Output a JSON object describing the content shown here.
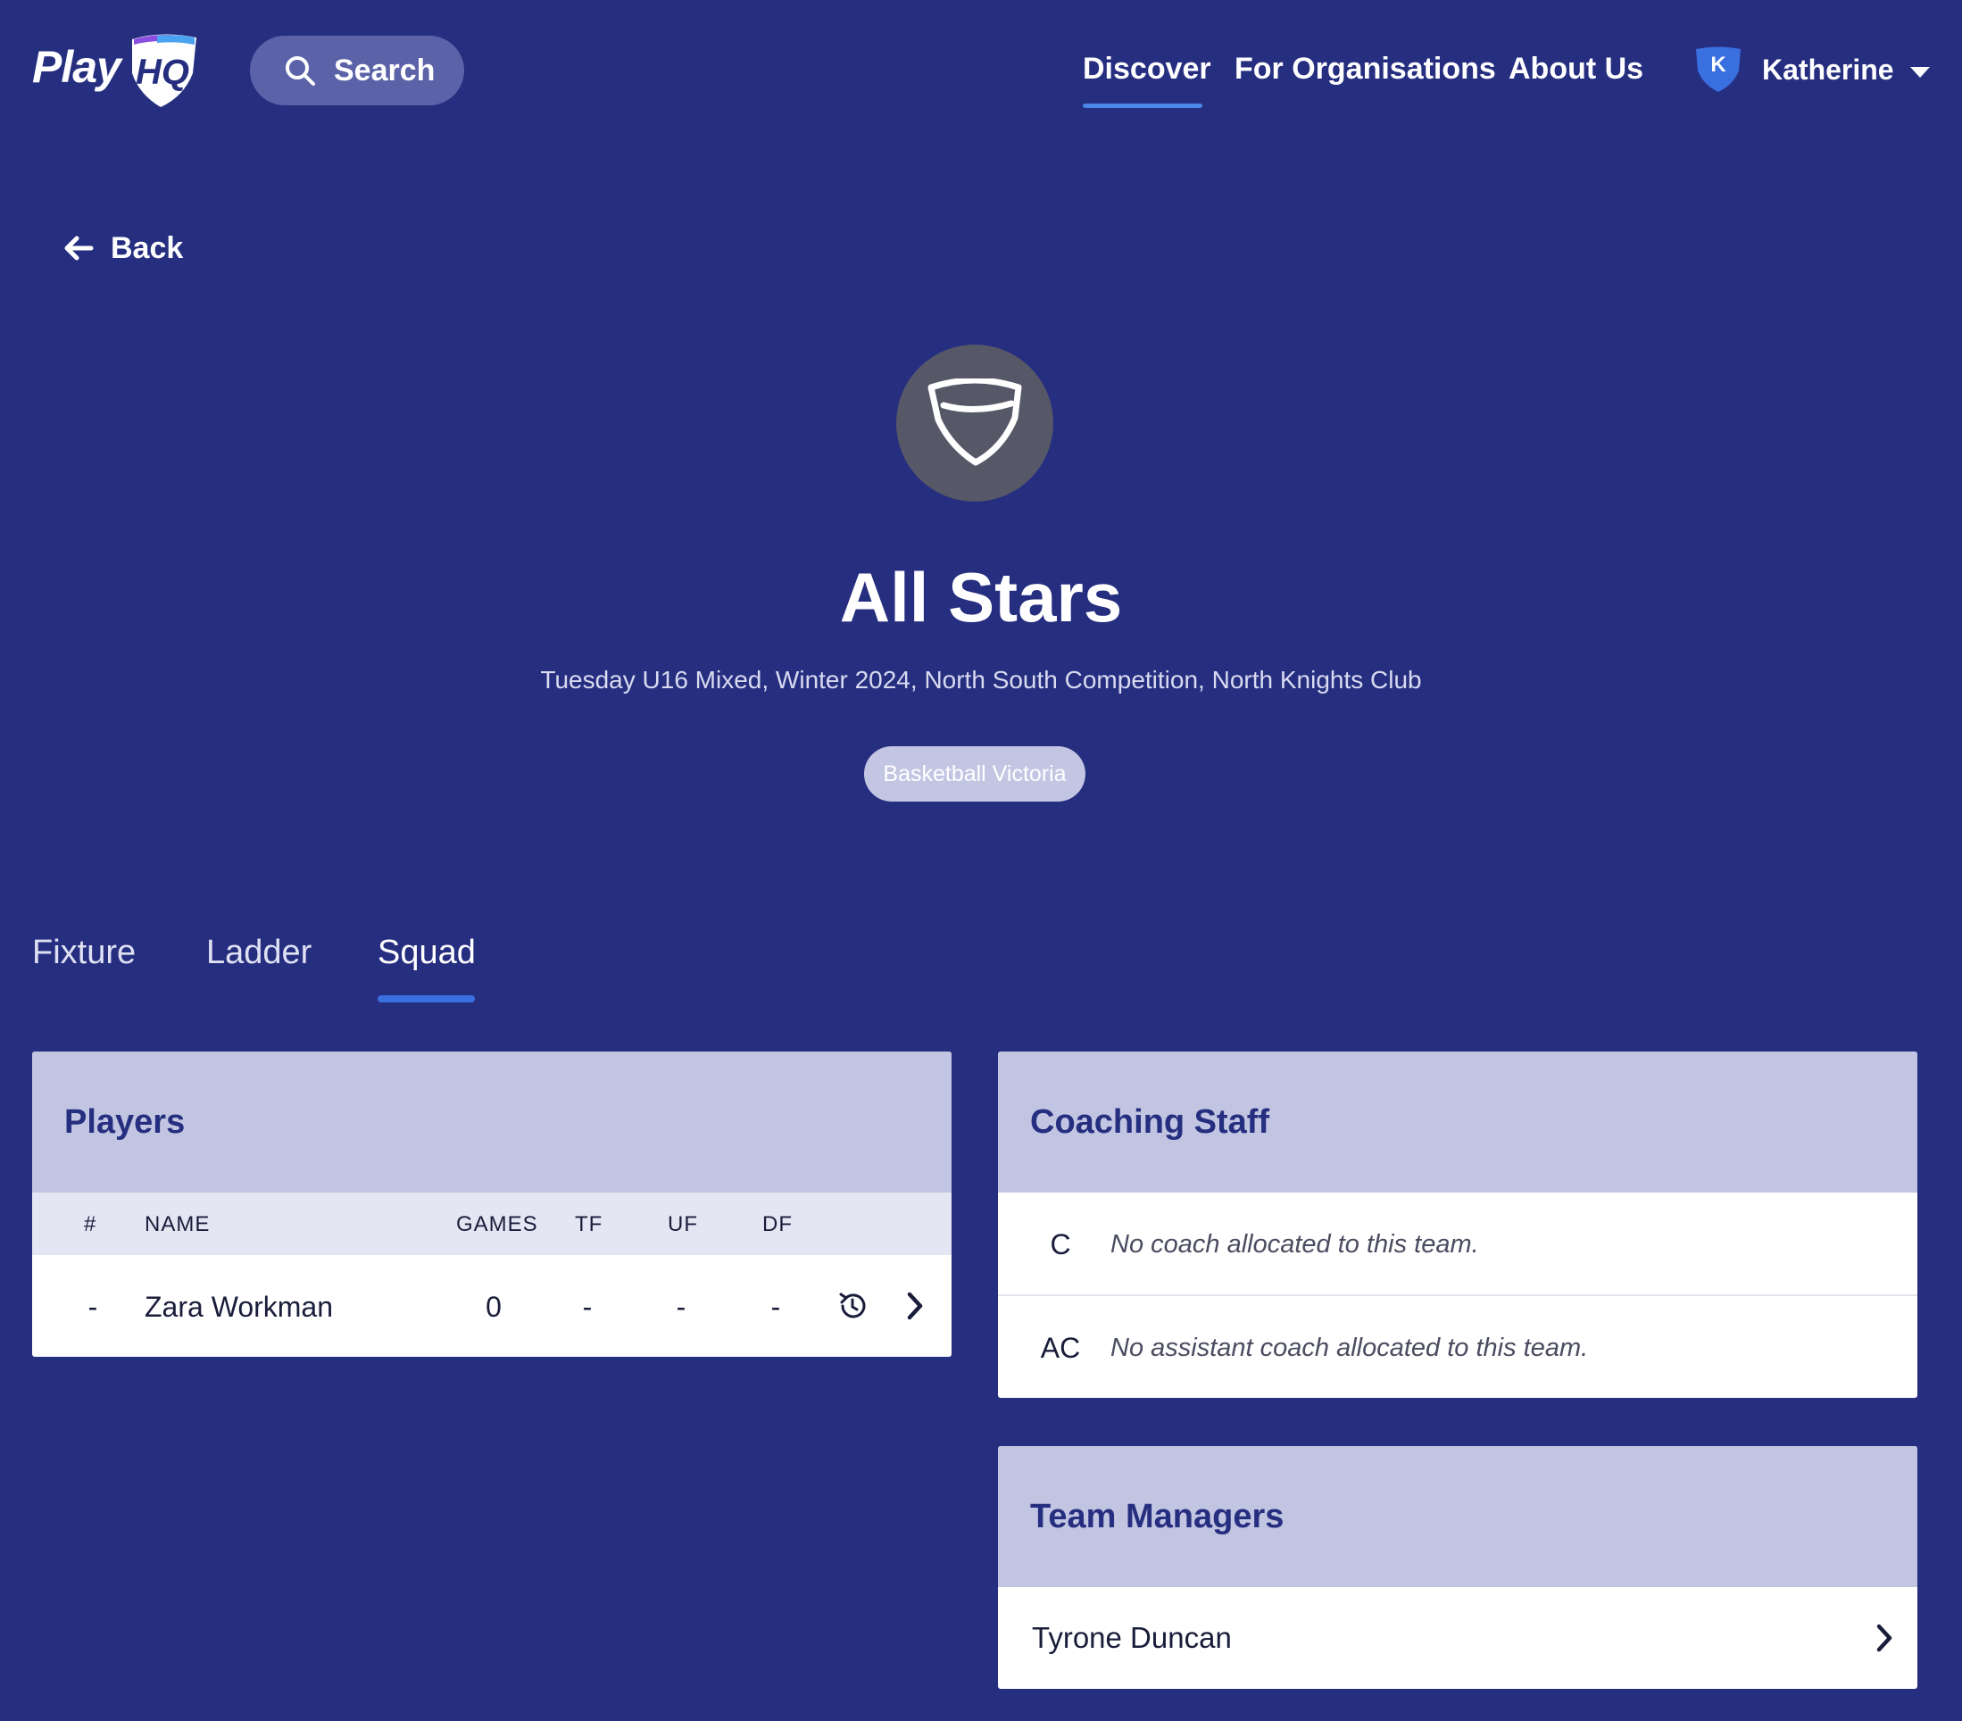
{
  "header": {
    "logo_text": "Play",
    "logo_hq": "HQ",
    "search_label": "Search",
    "nav": [
      "Discover",
      "For Organisations",
      "About Us"
    ],
    "active_nav": "Discover",
    "user": {
      "initial": "K",
      "name": "Katherine"
    }
  },
  "back_label": "Back",
  "team": {
    "name": "All Stars",
    "subtitle": "Tuesday U16 Mixed, Winter 2024, North South Competition, North Knights Club",
    "association": "Basketball Victoria"
  },
  "tabs": [
    "Fixture",
    "Ladder",
    "Squad"
  ],
  "active_tab": "Squad",
  "players_card": {
    "title": "Players",
    "columns": [
      "#",
      "NAME",
      "GAMES",
      "TF",
      "UF",
      "DF"
    ],
    "rows": [
      {
        "number": "-",
        "name": "Zara Workman",
        "games": "0",
        "tf": "-",
        "uf": "-",
        "df": "-"
      }
    ]
  },
  "coaching_card": {
    "title": "Coaching Staff",
    "rows": [
      {
        "role": "C",
        "message": "No coach allocated to this team."
      },
      {
        "role": "AC",
        "message": "No assistant coach allocated to this team."
      }
    ]
  },
  "managers_card": {
    "title": "Team Managers",
    "rows": [
      {
        "name": "Tyrone Duncan"
      }
    ]
  },
  "colors": {
    "background": "#262e80",
    "accent": "#3a6fe0",
    "card_header": "#c1c5e2",
    "heading": "#262e80"
  },
  "icons": [
    "search-icon",
    "arrow-left-icon",
    "chevron-down-icon",
    "shield-icon",
    "history-icon",
    "chevron-right-icon"
  ]
}
